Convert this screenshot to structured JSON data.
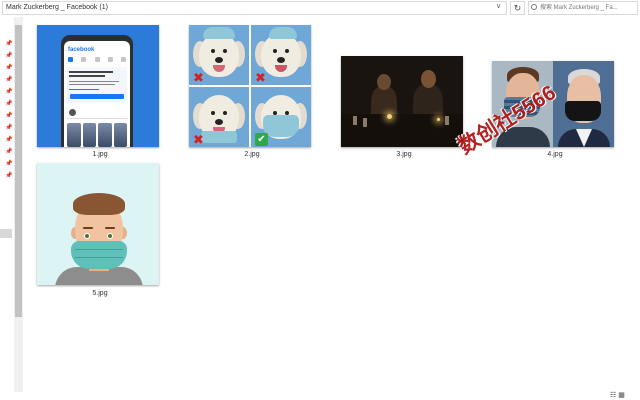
{
  "addressbar": {
    "path": "Mark Zuckerberg _ Facebook (1)",
    "chevron": "∨",
    "refresh_glyph": "↻"
  },
  "search": {
    "placeholder": "搜索 Mark Zuckerberg _ Fa..."
  },
  "files": [
    {
      "name": "1.jpg"
    },
    {
      "name": "2.jpg"
    },
    {
      "name": "3.jpg"
    },
    {
      "name": "4.jpg"
    },
    {
      "name": "5.jpg"
    }
  ],
  "thumb1": {
    "logo": "facebook"
  },
  "marks": {
    "x": "✖",
    "check": "✔"
  },
  "watermark": "数创社5566",
  "view_buttons": "☷ ▦",
  "icons": {
    "pin": "pin-icon",
    "search": "search-icon",
    "refresh": "refresh-icon",
    "chevron": "chevron-down-icon"
  },
  "colors": {
    "facebook_blue": "#1877f2",
    "watermark_red": "#b01818",
    "mask_teal": "#5ec0b8"
  }
}
